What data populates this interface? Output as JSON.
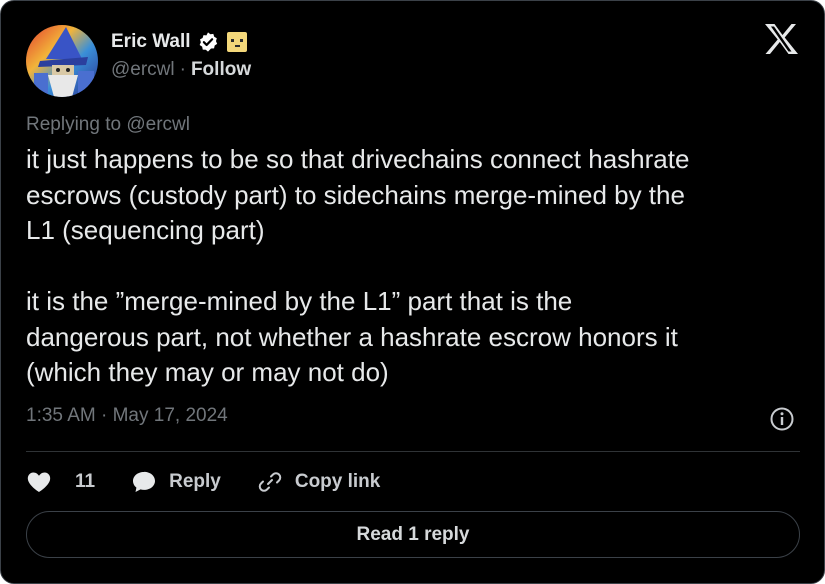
{
  "author": {
    "name": "Eric Wall",
    "handle": "@ercwl",
    "separator": "·",
    "follow_label": "Follow"
  },
  "reply_context": "Replying to @ercwl",
  "tweet": {
    "text": "it just happens to be so that drivechains connect hashrate\nescrows (custody part) to sidechains merge-mined by the\nL1 (sequencing part)\n\nit is the ”merge-mined by the L1” part that is the\ndangerous part, not whether a hashrate escrow honors it\n(which they may or may not do)",
    "timestamp": "1:35 AM · May 17, 2024"
  },
  "actions": {
    "like_count": "11",
    "reply_label": "Reply",
    "copy_link_label": "Copy link"
  },
  "read_replies_label": "Read 1 reply",
  "icons": {
    "verified": "verified-badge-icon",
    "emoji": "face-emoji-icon",
    "logo": "x-logo-icon",
    "info": "info-icon",
    "like": "heart-icon",
    "reply": "speech-bubble-icon",
    "copy": "link-icon"
  },
  "colors": {
    "background": "#000000",
    "text": "#e7e9ea",
    "muted": "#71767b",
    "border": "#3b4148",
    "verified": "#ffffff"
  }
}
